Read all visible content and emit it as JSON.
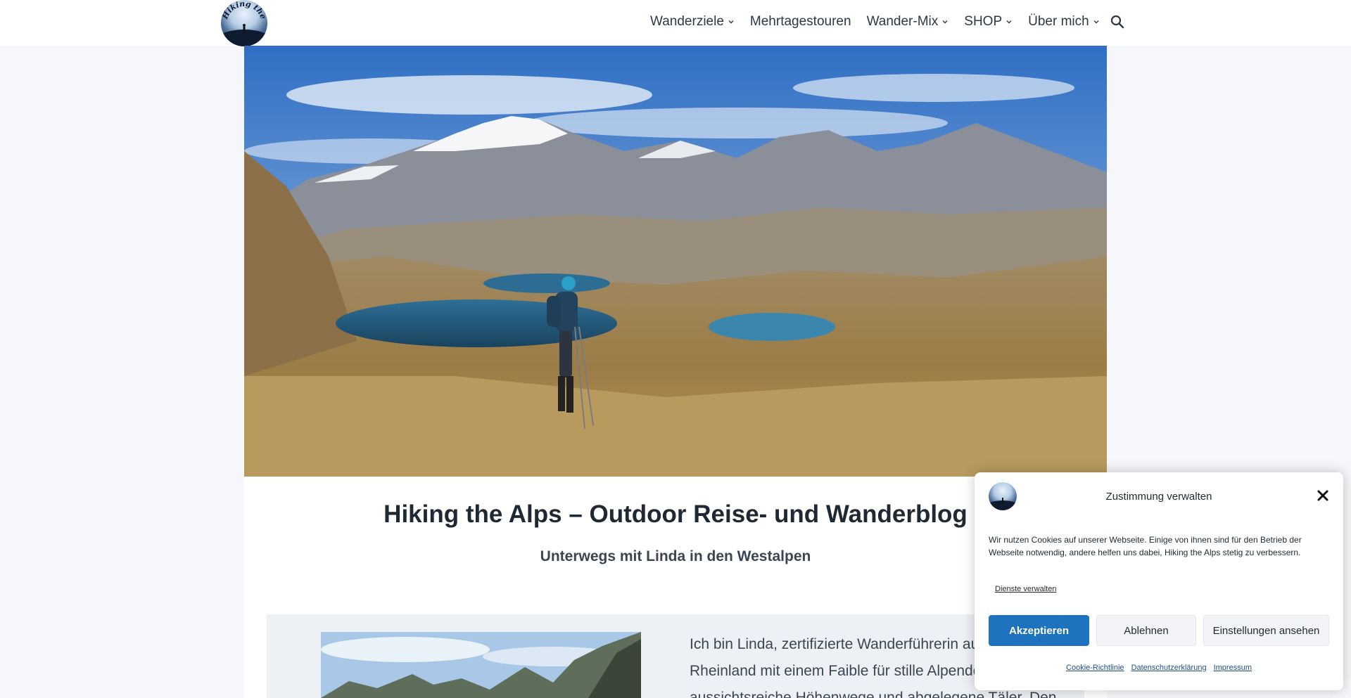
{
  "header": {
    "logo_alt": "Hiking the Alps",
    "nav": [
      {
        "label": "Wanderziele",
        "has_dropdown": true
      },
      {
        "label": "Mehrtagestouren",
        "has_dropdown": false
      },
      {
        "label": "Wander-Mix",
        "has_dropdown": true
      },
      {
        "label": "SHOP",
        "has_dropdown": true
      },
      {
        "label": "Über mich",
        "has_dropdown": true
      }
    ],
    "search_icon": "search-icon"
  },
  "hero": {
    "image": "alpine-lakes-hiker-photo"
  },
  "main": {
    "title": "Hiking the Alps – Outdoor Reise- und Wanderblog",
    "subtitle": "Unterwegs mit Linda in den Westalpen",
    "intro_text": "Ich bin Linda, zertifizierte Wanderführerin aus dem Rheinland mit einem Faible für stille Alpendörfer, aussichtsreiche Höhenwege und abgelegene Täler. Den"
  },
  "cookie": {
    "title": "Zustimmung verwalten",
    "message": "Wir nutzen Cookies auf unserer Webseite. Einige von ihnen sind für den Betrieb der Webseite notwendig, andere helfen uns dabei, Hiking the Alps stetig zu verbessern.",
    "manage_services": "Dienste verwalten",
    "accept": "Akzeptieren",
    "deny": "Ablehnen",
    "view_settings": "Einstellungen ansehen",
    "links": [
      "Cookie-Richtlinie",
      "Datenschutzerklärung",
      "Impressum"
    ],
    "accent_color": "#1e73be"
  }
}
